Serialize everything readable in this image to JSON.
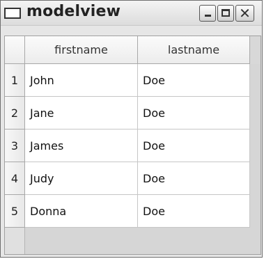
{
  "window": {
    "title": "modelview",
    "buttons": {
      "minimize": "minimize",
      "maximize": "maximize",
      "close": "✕"
    }
  },
  "table": {
    "columns": [
      "firstname",
      "lastname"
    ],
    "rows": [
      {
        "num": "1",
        "firstname": "John",
        "lastname": "Doe"
      },
      {
        "num": "2",
        "firstname": "Jane",
        "lastname": "Doe"
      },
      {
        "num": "3",
        "firstname": "James",
        "lastname": "Doe"
      },
      {
        "num": "4",
        "firstname": "Judy",
        "lastname": "Doe"
      },
      {
        "num": "5",
        "firstname": "Donna",
        "lastname": "Doe"
      }
    ]
  }
}
